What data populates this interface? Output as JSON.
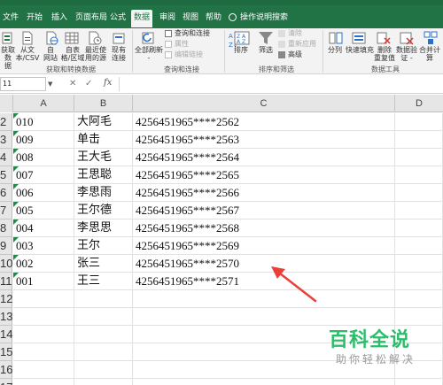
{
  "tabs": [
    "文件",
    "开始",
    "插入",
    "页面布局",
    "公式",
    "数据",
    "审阅",
    "视图",
    "帮助"
  ],
  "active_tab": "数据",
  "tell_me": "操作说明搜索",
  "ribbon": {
    "get_data": {
      "buttons": [
        {
          "line1": "获取数",
          "line2": "据"
        },
        {
          "line1": "从文",
          "line2": "本/CSV"
        },
        {
          "line1": "自",
          "line2": "网站"
        },
        {
          "line1": "自表",
          "line2": "格/区域"
        },
        {
          "line1": "最近使",
          "line2": "用的源"
        },
        {
          "line1": "现有",
          "line2": "连接"
        }
      ],
      "group_label": "获取和转换数据"
    },
    "queries": {
      "refresh_all": {
        "line1": "全部刷新",
        "line2": "-"
      },
      "items": [
        "查询和连接",
        "属性",
        "编辑链接"
      ],
      "group_label": "查询和连接"
    },
    "sort_filter": {
      "sort_label": "排序",
      "filter_label": "筛选",
      "items": [
        "清除",
        "重新应用",
        "高级"
      ],
      "group_label": "排序和筛选"
    },
    "data_tools": {
      "buttons": [
        {
          "line1": "分列",
          "line2": ""
        },
        {
          "line1": "快速填充",
          "line2": ""
        },
        {
          "line1": "删除",
          "line2": "重复值"
        },
        {
          "line1": "数据验",
          "line2": "证 -"
        },
        {
          "line1": "合并计算",
          "line2": ""
        }
      ],
      "group_label": "数据工具"
    }
  },
  "formula_bar": {
    "name_box": "11",
    "cancel": "✕",
    "confirm": "✓",
    "fx": "fx",
    "value": ""
  },
  "columns": [
    "A",
    "B",
    "C",
    "D"
  ],
  "row_numbers": [
    "2",
    "3",
    "4",
    "5",
    "6",
    "7",
    "8",
    "9",
    "10",
    "11",
    "12",
    "13",
    "14",
    "15",
    "16",
    "17"
  ],
  "rows": [
    {
      "a": "010",
      "b": "大阿毛",
      "c": "4256451965****2562"
    },
    {
      "a": "009",
      "b": "单击",
      "c": "4256451965****2563"
    },
    {
      "a": "008",
      "b": "王大毛",
      "c": "4256451965****2564"
    },
    {
      "a": "007",
      "b": "王思聪",
      "c": "4256451965****2565"
    },
    {
      "a": "006",
      "b": "李思雨",
      "c": "4256451965****2566"
    },
    {
      "a": "005",
      "b": "王尔德",
      "c": "4256451965****2567"
    },
    {
      "a": "004",
      "b": "李思思",
      "c": "4256451965****2568"
    },
    {
      "a": "003",
      "b": "王尔",
      "c": "4256451965****2569"
    },
    {
      "a": "002",
      "b": "张三",
      "c": "4256451965****2570"
    },
    {
      "a": "001",
      "b": "王三",
      "c": "4256451965****2571"
    }
  ],
  "watermark": {
    "title": "百科全说",
    "subtitle": "助你轻松解决"
  },
  "colors": {
    "excel_green": "#217346",
    "annotation_arrow": "#e8403a",
    "watermark_green": "#2bbd6a"
  }
}
